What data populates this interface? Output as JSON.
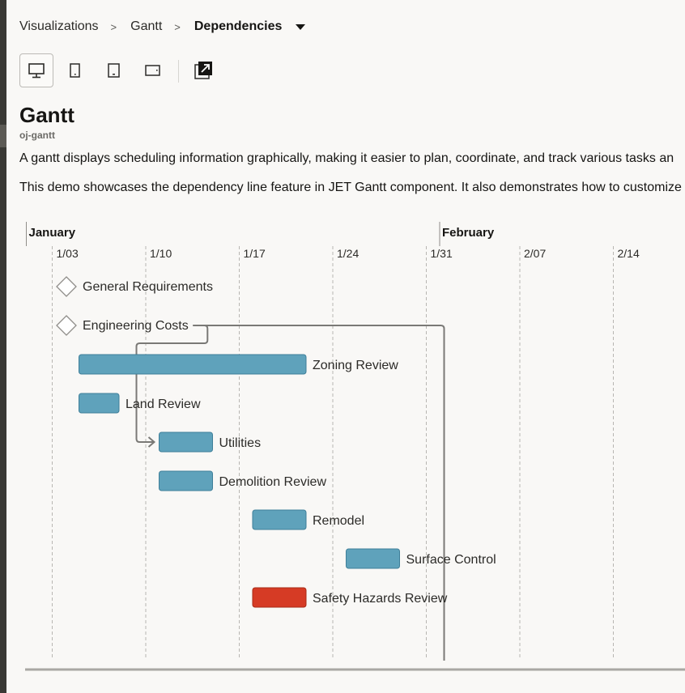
{
  "breadcrumb": {
    "items": [
      "Visualizations",
      "Gantt"
    ],
    "separator": ">",
    "current": "Dependencies"
  },
  "toolbar": {
    "buttons": [
      {
        "name": "desktop-view",
        "icon": "monitor-icon",
        "selected": true
      },
      {
        "name": "tablet-portrait-view",
        "icon": "tablet-portrait-icon",
        "selected": false
      },
      {
        "name": "phone-view",
        "icon": "phone-icon",
        "selected": false
      },
      {
        "name": "tablet-landscape-view",
        "icon": "tablet-landscape-icon",
        "selected": false
      },
      {
        "name": "open-new-window",
        "icon": "external-window-icon",
        "selected": false
      }
    ]
  },
  "page": {
    "title": "Gantt",
    "subtitle": "oj-gantt",
    "desc1": "A gantt displays scheduling information graphically, making it easier to plan, coordinate, and track various tasks an",
    "desc2": "This demo showcases the dependency line feature in JET Gantt component. It also demonstrates how to customize"
  },
  "gantt": {
    "major_labels": [
      {
        "label": "January",
        "date": "2024-01-01"
      },
      {
        "label": "February",
        "date": "2024-02-01"
      }
    ],
    "minor_labels": [
      "1/03",
      "1/10",
      "1/17",
      "1/24",
      "1/31",
      "2/07",
      "2/14"
    ],
    "colors": {
      "task": "#5fa2bb",
      "task_border": "#3f7f99",
      "critical": "#d63b25",
      "critical_border": "#a82b17",
      "dependency": "#7a7976",
      "grid": "#b8b6b2"
    },
    "tasks": [
      {
        "label": "General Requirements",
        "type": "milestone",
        "start": "2024-01-04"
      },
      {
        "label": "Engineering Costs",
        "type": "milestone",
        "start": "2024-01-04"
      },
      {
        "label": "Zoning Review",
        "type": "task",
        "start": "2024-01-05",
        "end": "2024-01-22"
      },
      {
        "label": "Land Review",
        "type": "task",
        "start": "2024-01-05",
        "end": "2024-01-08"
      },
      {
        "label": "Utilities",
        "type": "task",
        "start": "2024-01-11",
        "end": "2024-01-15"
      },
      {
        "label": "Demolition Review",
        "type": "task",
        "start": "2024-01-11",
        "end": "2024-01-15"
      },
      {
        "label": "Remodel",
        "type": "task",
        "start": "2024-01-18",
        "end": "2024-01-22"
      },
      {
        "label": "Surface Control",
        "type": "task",
        "start": "2024-01-25",
        "end": "2024-01-29"
      },
      {
        "label": "Safety Hazards Review",
        "type": "critical",
        "start": "2024-01-18",
        "end": "2024-01-22"
      }
    ],
    "dependencies": [
      {
        "from": "Engineering Costs",
        "to": "Utilities"
      },
      {
        "from": "Engineering Costs",
        "to": "Safety Hazards Review"
      }
    ]
  }
}
